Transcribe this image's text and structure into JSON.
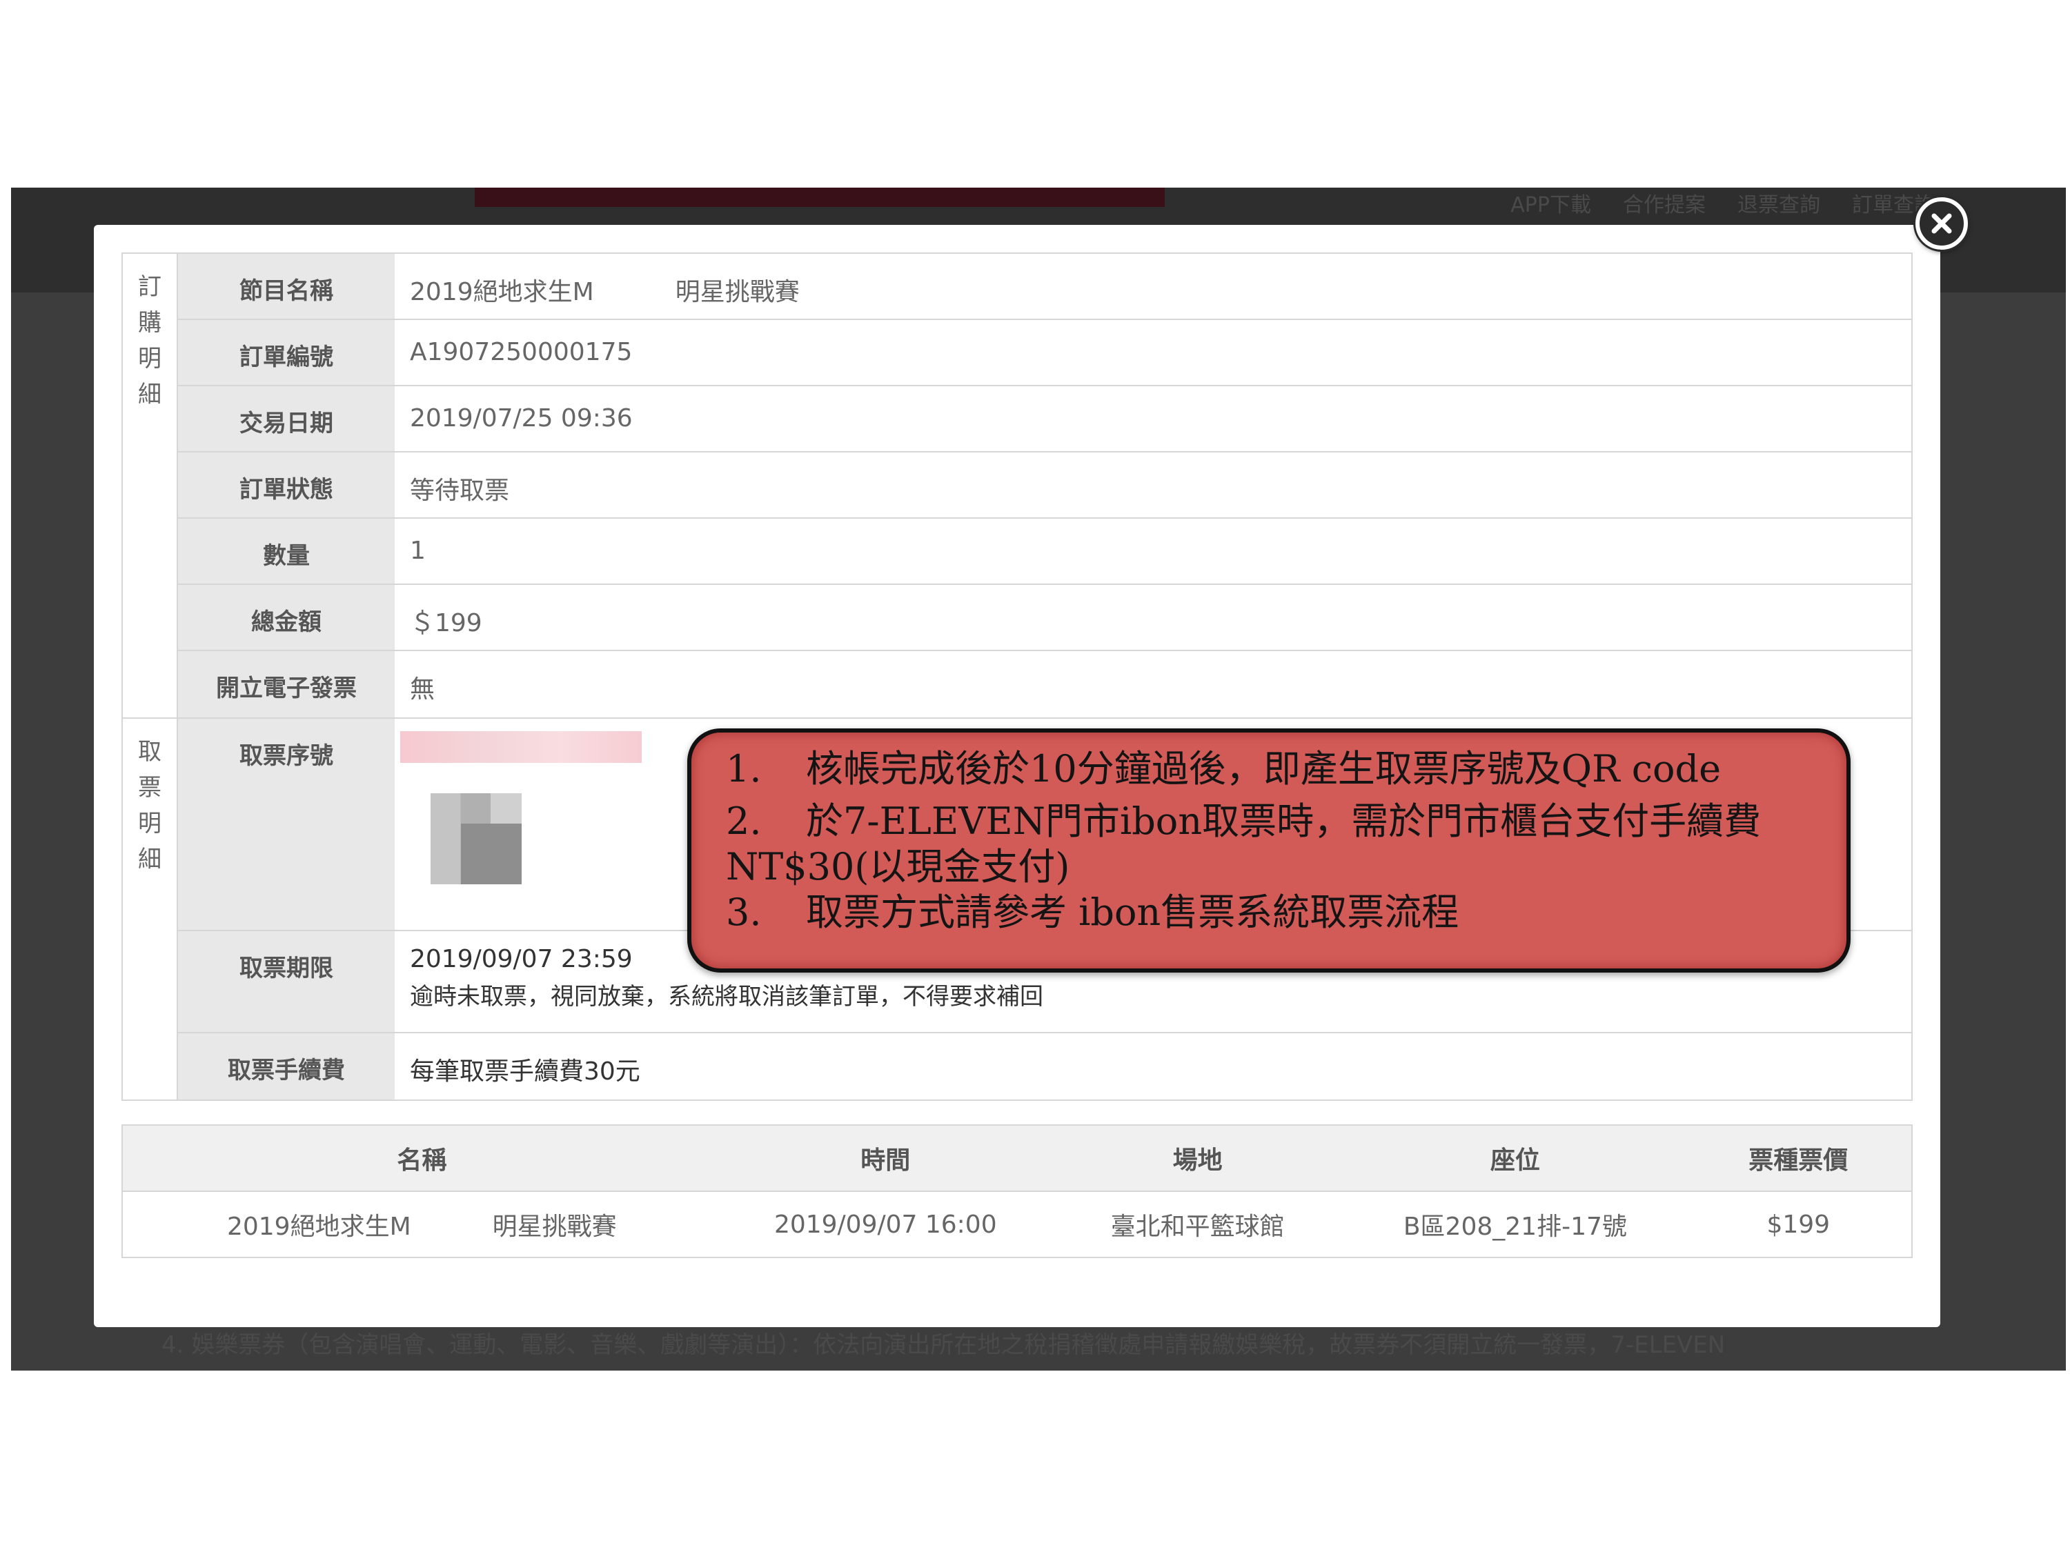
{
  "background": {
    "nav": [
      "APP下載",
      "合作提案",
      "退票查詢",
      "訂單查詢"
    ],
    "footnote": "4. 娛樂票券（包含演唱會、運動、電影、音樂、戲劇等演出）：依法向演出所在地之稅捐稽徵處申請報繳娛樂稅，故票券不須開立統一發票，7-ELEVEN"
  },
  "order_section": {
    "label": [
      "訂",
      "購",
      "明",
      "細"
    ],
    "fields": [
      {
        "label": "節目名稱",
        "value_a": "2019絕地求生M",
        "value_b": "明星挑戰賽"
      },
      {
        "label": "訂單編號",
        "value": "A1907250000175"
      },
      {
        "label": "交易日期",
        "value": "2019/07/25 09:36"
      },
      {
        "label": "訂單狀態",
        "value": "等待取票"
      },
      {
        "label": "數量",
        "value": "1"
      },
      {
        "label": "總金額",
        "value": "＄199"
      },
      {
        "label": "開立電子發票",
        "value": "無"
      }
    ]
  },
  "pickup_section": {
    "label": [
      "取",
      "票",
      "明",
      "細"
    ],
    "serial_label": "取票序號",
    "deadline_label": "取票期限",
    "deadline_value": "2019/09/07 23:59",
    "deadline_note": "逾時未取票，視同放棄，系統將取消該筆訂單，不得要求補回",
    "fee_label": "取票手續費",
    "fee_value": "每筆取票手續費30元"
  },
  "items_table": {
    "headers": [
      "名稱",
      "時間",
      "場地",
      "座位",
      "票種票價"
    ],
    "row": {
      "name_a": "2019絕地求生M",
      "name_b": "明星挑戰賽",
      "time": "2019/09/07 16:00",
      "venue": "臺北和平籃球館",
      "seat": "B區208_21排-17號",
      "price": "$199"
    }
  },
  "callout": {
    "items": [
      {
        "num": "1.",
        "text": "核帳完成後於10分鐘過後，即產生取票序號及QR code"
      },
      {
        "num": "2.",
        "text": "於7-ELEVEN門市ibon取票時，需於門市櫃台支付手續費",
        "text2": "NT$30(以現金支付)"
      },
      {
        "num": "3.",
        "text": "取票方式請參考 ibon售票系統取票流程"
      }
    ]
  },
  "colors": {
    "callout": "#d25b58",
    "label_bg": "#e8e8e8",
    "overlay": "#3d3d3d"
  }
}
